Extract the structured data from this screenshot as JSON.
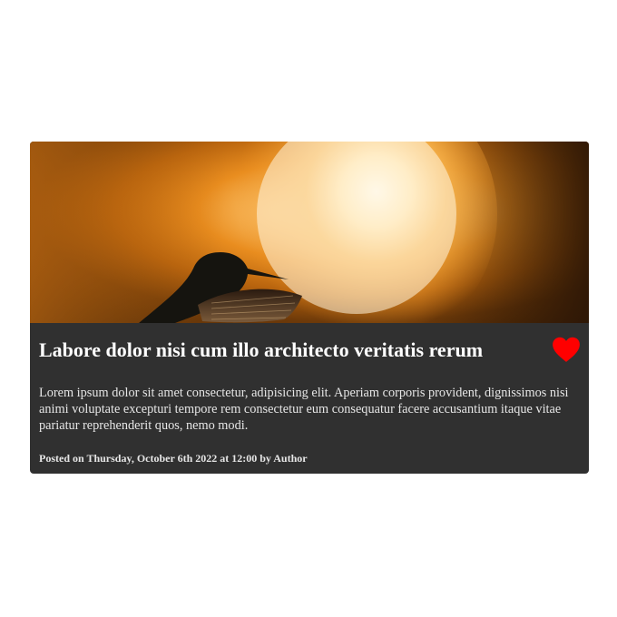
{
  "card": {
    "image": {
      "subject": "hummingbird silhouette against sunset glow",
      "colors": {
        "glow": "#ffe9c4",
        "orange": "#e98d1f",
        "dark": "#3a1f07"
      }
    },
    "title": "Labore dolor nisi cum illo architecto veritatis rerum",
    "like_icon": "heart-icon",
    "like_color": "#ff0000",
    "description": "Lorem ipsum dolor sit amet consectetur, adipisicing elit. Aperiam corporis provident, dignissimos nisi animi voluptate excepturi tempore rem consectetur eum consequatur facere accusantium itaque vitae pariatur reprehenderit quos, nemo modi.",
    "meta": "Posted on Thursday, October 6th 2022 at 12:00 by Author",
    "background": "#303030"
  }
}
